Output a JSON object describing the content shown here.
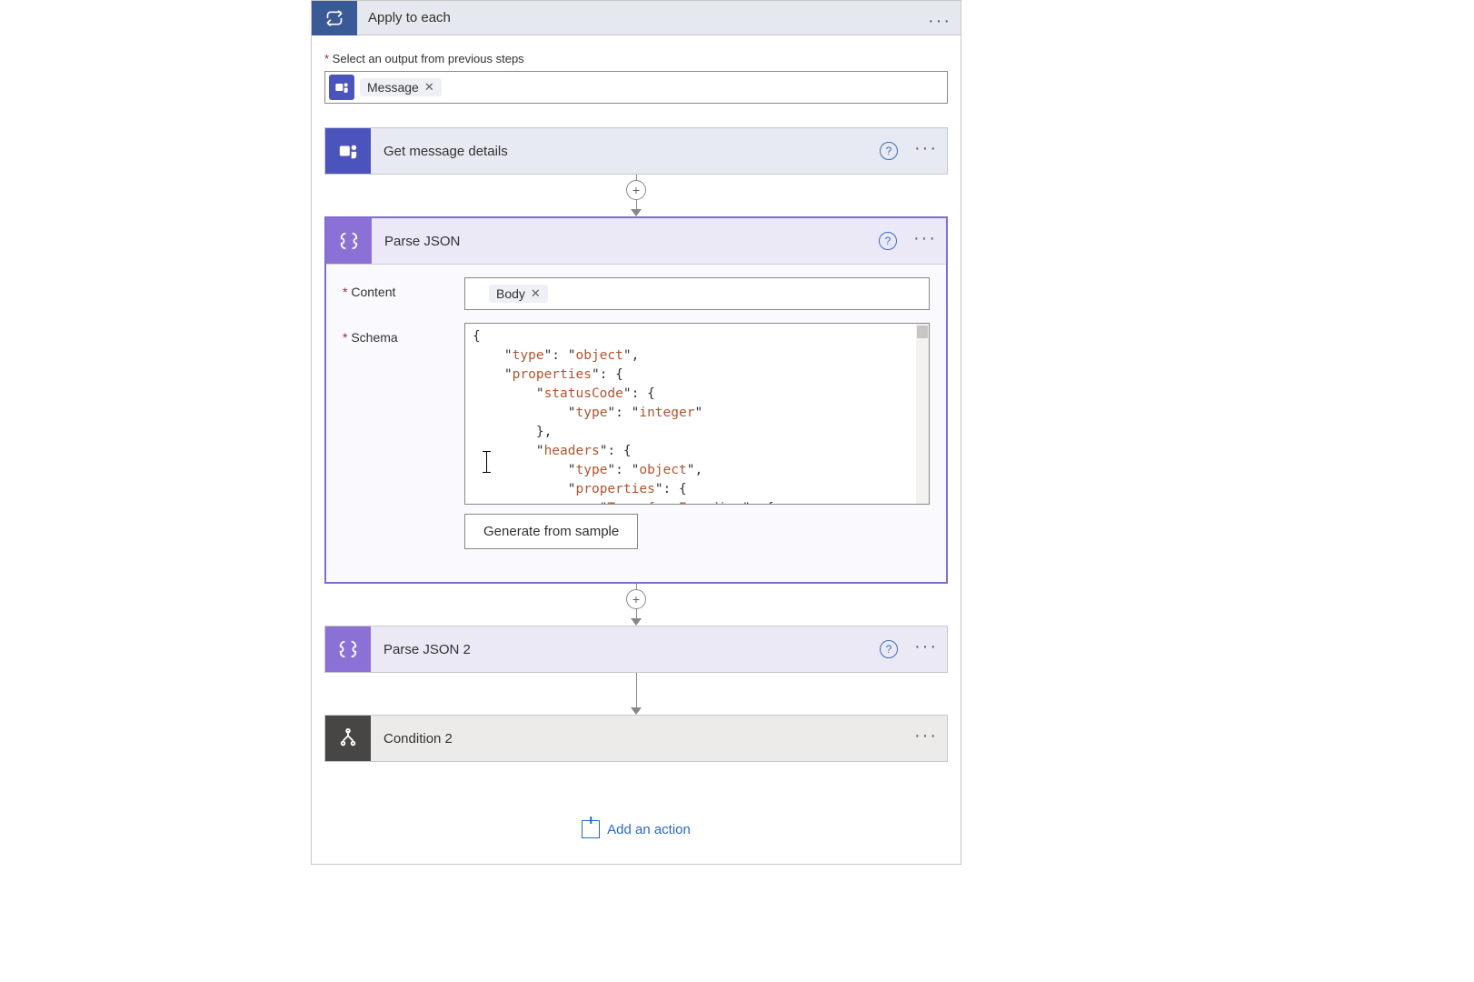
{
  "outer": {
    "title": "Apply to each",
    "select_label": "Select an output from previous steps",
    "token": "Message"
  },
  "steps": {
    "get_msg": {
      "title": "Get message details"
    },
    "parse1": {
      "title": "Parse JSON",
      "content_label": "Content",
      "content_token": "Body",
      "schema_label": "Schema",
      "gen_button": "Generate from sample"
    },
    "parse2": {
      "title": "Parse JSON 2"
    },
    "cond": {
      "title": "Condition 2"
    }
  },
  "schema_lines": [
    {
      "indent": 0,
      "text_plain": "{"
    },
    {
      "indent": 1,
      "key": "type",
      "val": "object",
      "trail": ","
    },
    {
      "indent": 1,
      "key": "properties",
      "post": ": {"
    },
    {
      "indent": 2,
      "key": "statusCode",
      "post": ": {"
    },
    {
      "indent": 3,
      "key": "type",
      "val": "integer"
    },
    {
      "indent": 2,
      "text_plain": "},"
    },
    {
      "indent": 2,
      "key": "headers",
      "post": ": {"
    },
    {
      "indent": 3,
      "key": "type",
      "val": "object",
      "trail": ","
    },
    {
      "indent": 3,
      "key": "properties",
      "post": ": {"
    },
    {
      "indent": 4,
      "key": "Transfer-Encoding",
      "post": ": {"
    }
  ],
  "add_action": "Add an action",
  "colors": {
    "teams": "#4b53bc",
    "purple": "#8b70d6",
    "dark": "#484644",
    "link": "#2b67c7"
  }
}
